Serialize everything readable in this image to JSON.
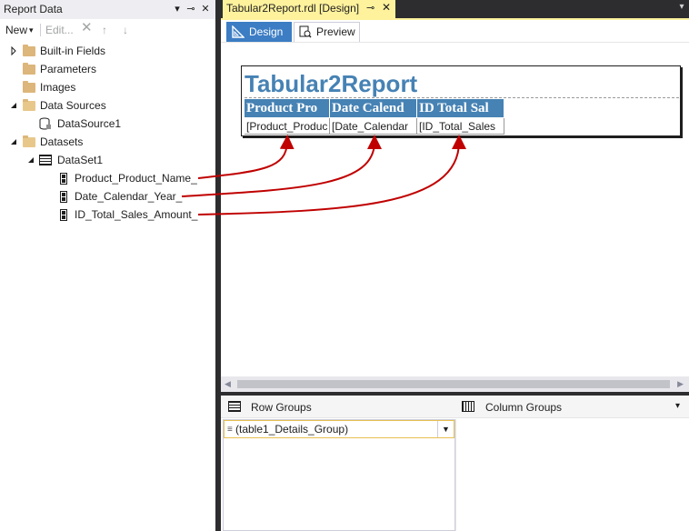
{
  "report_data_panel": {
    "title": "Report Data",
    "pin_icon": "pin-icon",
    "close_icon": "close-icon",
    "toolbar": {
      "new_label": "New",
      "edit_label": "Edit..."
    },
    "tree": {
      "builtin_fields": "Built-in Fields",
      "parameters": "Parameters",
      "images": "Images",
      "data_sources": "Data Sources",
      "data_source_1": "DataSource1",
      "datasets": "Datasets",
      "dataset_1": "DataSet1",
      "fields": [
        "Product_Product_Name_",
        "Date_Calendar_Year_",
        "ID_Total_Sales_Amount_"
      ]
    }
  },
  "document": {
    "tab_title": "Tabular2Report.rdl [Design]",
    "pin_glyph": "⊸",
    "close_glyph": "✕",
    "view_tabs": {
      "design": "Design",
      "preview": "Preview"
    },
    "report": {
      "title": "Tabular2Report",
      "headers": [
        "Product Pro",
        "Date Calend",
        "ID Total Sal"
      ],
      "cells": [
        "[Product_Produc",
        "[Date_Calendar",
        "[ID_Total_Sales"
      ]
    },
    "grouping": {
      "row_groups_label": "Row Groups",
      "column_groups_label": "Column Groups",
      "row_group_item": "(table1_Details_Group)"
    }
  },
  "colors": {
    "accent_blue": "#3c7dc4",
    "report_header_bg": "#4682b4",
    "report_title": "#4682b4",
    "tab_yellow": "#fff29d",
    "annotation_arrow": "#c00000",
    "chrome_dark": "#2d2d30"
  }
}
